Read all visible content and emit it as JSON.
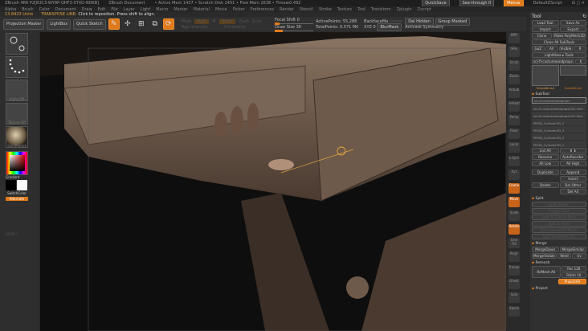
{
  "titlebar": {
    "app": "ZBrush 4R6 P2[B3C3-WY9P-QHF3-STXD-NDKB]",
    "doc": "ZBrush Document",
    "stats": "• Active Mem 1437 • Scratch Disk 2451 • Free Mem 2638 • Timer▸0.492",
    "quicksave": "QuickSave",
    "seethrough": "See-through  0",
    "menus_btn": "Menus",
    "script": "DefaultZScript"
  },
  "menubar": [
    "Alpha",
    "Brush",
    "Color",
    "Document",
    "Draw",
    "Edit",
    "File",
    "Layer",
    "Light",
    "Macro",
    "Marker",
    "Material",
    "Movie",
    "Picker",
    "Preferences",
    "Render",
    "Stencil",
    "Stroke",
    "Texture",
    "Tool",
    "Transform",
    "Zplugin",
    "Zscript"
  ],
  "notebar": {
    "units": "13.8423 Units",
    "hint_label": "TRANSPOSE LINE:",
    "hint": "Click to reposition. Press shift to align."
  },
  "toolbar": {
    "projection_master": "Projection Master",
    "lightbox": "LightBox",
    "quick_sketch": "Quick Sketch",
    "edit": "Edit",
    "draw": "Draw",
    "move": "Move",
    "scale": "Scale",
    "rotate": "Rotate",
    "mrgb": "Mrgb",
    "rgb": "Rgb",
    "m": "M",
    "zadd": "Zadd",
    "zsub": "Zsub",
    "zcut": "Zcut",
    "rgb_intensity": "Rgb Intensity",
    "z_intensity": "Z Intensity",
    "focal_shift": "Focal Shift 0",
    "draw_size": "Draw Size 36",
    "dynamic": "Dynamic",
    "active_points": "ActivePoints: 55,288",
    "total_points": "TotalPoints: 0.571 Mil",
    "backface": "BackfaceMa",
    "delete": "Delete",
    "xyz": "XYZ 0",
    "blurmask": "BlurMask",
    "del_hidden": "Del Hidden",
    "group_masked": "Group Masked",
    "activate_symmetry": "Activate Symmetry"
  },
  "leftshelf": {
    "transpose": "Transpose",
    "dots": "Dots",
    "alpha_off": "Alpha Off",
    "texture_off": "Texture Off",
    "material": "SkinShade4",
    "gradient": "Gradient",
    "switch_color": "SwitchColor",
    "alternate": "Alternate",
    "ratio": "RATIO 1"
  },
  "rightshelf": [
    "BPR",
    "SPix",
    "Scroll",
    "Zoom",
    "Actual",
    "AAHalf",
    "Persp",
    "Floor",
    "Local",
    "L.Sym",
    "Xyz",
    "Frame",
    "Move",
    "Scale",
    "Rotate",
    "Line Fill",
    "PolyF",
    "Transp",
    "Ghost",
    "Solo",
    "Xpose"
  ],
  "toolpanel": {
    "title": "Tool",
    "buttons": [
      [
        "Load Tool",
        "Save As"
      ],
      [
        "Import",
        "Export"
      ],
      [
        "Clone",
        "Make PolyMesh3D"
      ],
      [
        "Clone All SubTools"
      ],
      [
        "GoZ",
        "All",
        "Visible",
        "R"
      ],
      [
        "Lighthbox ▸ Tools"
      ]
    ],
    "current_tool": "sci-fi-costumeandprops",
    "tool_count": "6",
    "thumbs": [
      "sci-fi-costumeandprops",
      "AlphaBrush",
      "SimpleBrush",
      "EraserBrush"
    ],
    "subtool_title": "SubTool",
    "subtools": [
      "sci-fi-costumeandprops",
      "sci-fi-costumeandprops2VO-Fem",
      "sci-fi-costumeandprops2VO-Fem",
      "PM3D_Cylinder3D_2",
      "PM3D_Cylinder3D_3",
      "PM3D_Cylinder3D_2",
      "PM3D_Cylinder3D_1"
    ],
    "list": {
      "list_all": "List All",
      "rename": "Rename",
      "autoreorder": "AutoReorder",
      "all_low": "All Low",
      "all_high": "All High",
      "duplicate": "Duplicate",
      "append": "Append",
      "insert": "Insert",
      "delete": "Delete",
      "del_other": "Del Other",
      "del_all": "Del All"
    },
    "split": {
      "title": "Split",
      "items": [
        "Split Hidden",
        "Groups Split",
        "Split To Similar Parts",
        "Split To Parts",
        "Split Unmasked Points",
        "Split Masked Points"
      ]
    },
    "merge": {
      "title": "Merge",
      "items": [
        "MergeDown",
        "MergeSimilar",
        "MergeVisible",
        "Weld",
        "Uv"
      ]
    },
    "remesh": {
      "title": "Remesh",
      "remesh_all": "ReMesh All",
      "res": "Res 128",
      "polish": "Polish 10",
      "project_all": "ProjectAll"
    },
    "project": "Project"
  }
}
